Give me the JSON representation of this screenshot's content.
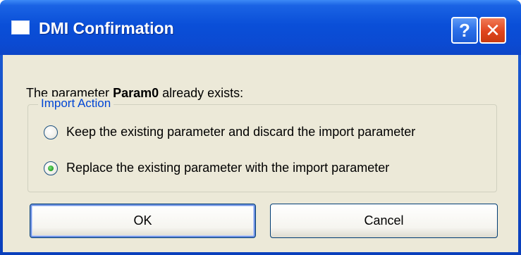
{
  "window": {
    "title": "DMI Confirmation",
    "help_glyph": "?",
    "close_glyph": "✕",
    "titlebar_color": "#0a4fd8",
    "client_bg": "#ece9d8"
  },
  "message": {
    "prefix": "The parameter ",
    "param_name": "Param0",
    "suffix": " already exists:"
  },
  "import_action": {
    "legend": "Import Action",
    "legend_color": "#0046d5",
    "options": [
      {
        "label": "Keep the existing parameter and discard the import parameter",
        "checked": false
      },
      {
        "label": "Replace the existing parameter with the import parameter",
        "checked": true
      }
    ]
  },
  "buttons": {
    "ok_label": "OK",
    "cancel_label": "Cancel"
  }
}
